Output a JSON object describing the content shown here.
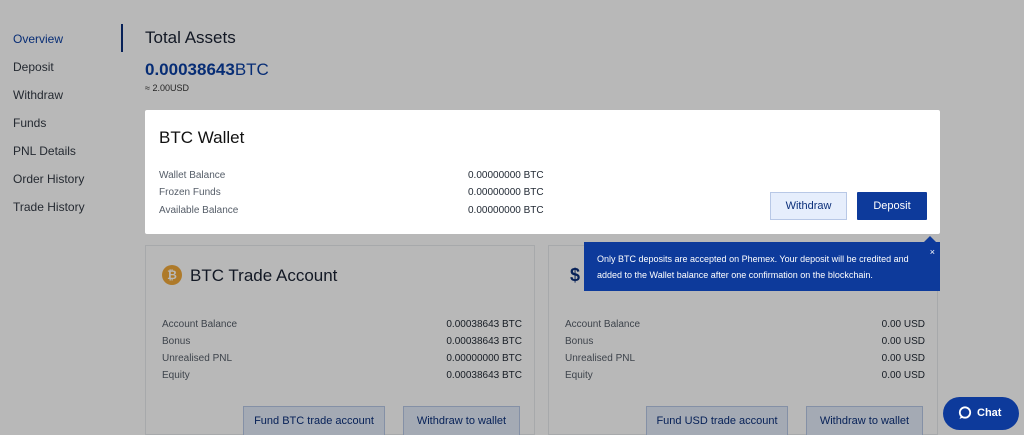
{
  "sidebar": {
    "items": [
      {
        "label": "Overview"
      },
      {
        "label": "Deposit"
      },
      {
        "label": "Withdraw"
      },
      {
        "label": "Funds"
      },
      {
        "label": "PNL Details"
      },
      {
        "label": "Order History"
      },
      {
        "label": "Trade History"
      }
    ]
  },
  "summary": {
    "title": "Total Assets",
    "btc_amount": "0.00038643",
    "btc_unit": "BTC",
    "usd_approx": "≈ 2.00USD"
  },
  "modal": {
    "title": "BTC Wallet",
    "rows": [
      {
        "label": "Wallet Balance",
        "value": "0.00000000 BTC"
      },
      {
        "label": "Frozen Funds",
        "value": "0.00000000 BTC"
      },
      {
        "label": "Available Balance",
        "value": "0.00000000 BTC"
      }
    ],
    "withdraw_label": "Withdraw",
    "deposit_label": "Deposit"
  },
  "tooltip": {
    "text": "Only BTC deposits are accepted on Phemex. Your deposit will be credited and added to the Wallet balance after one confirmation on the blockchain.",
    "close": "×"
  },
  "btc_account": {
    "icon": "bitcoin-icon",
    "icon_glyph": "₿",
    "title": "BTC Trade Account",
    "rows": [
      {
        "label": "Account Balance",
        "value": "0.00038643 BTC"
      },
      {
        "label": "Bonus",
        "value": "0.00038643 BTC"
      },
      {
        "label": "Unrealised PNL",
        "value": "0.00000000 BTC"
      },
      {
        "label": "Equity",
        "value": "0.00038643 BTC"
      }
    ],
    "fund_label": "Fund BTC trade account",
    "withdraw_label": "Withdraw to wallet"
  },
  "usd_account": {
    "icon": "dollar-icon",
    "icon_glyph": "$",
    "rows": [
      {
        "label": "Account Balance",
        "value": "0.00 USD"
      },
      {
        "label": "Bonus",
        "value": "0.00 USD"
      },
      {
        "label": "Unrealised PNL",
        "value": "0.00 USD"
      },
      {
        "label": "Equity",
        "value": "0.00 USD"
      }
    ],
    "fund_label": "Fund USD trade account",
    "withdraw_label": "Withdraw to wallet"
  },
  "chat": {
    "label": "Chat"
  },
  "colors": {
    "accent": "#0d3a9b",
    "overlay": "rgba(0,0,0,0.28)",
    "btc_orange": "#f2a93b"
  }
}
